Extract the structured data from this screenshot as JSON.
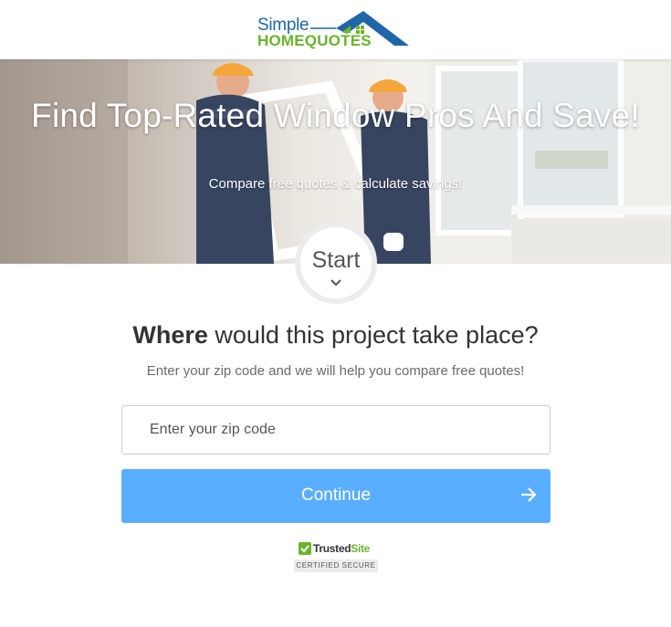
{
  "header": {
    "logo_simple": "Simple",
    "logo_homequotes": "HOMEQUOTES"
  },
  "hero": {
    "title": "Find Top-Rated Window Pros And Save!",
    "subtitle": "Compare free quotes & calculate savings!"
  },
  "start": {
    "label": "Start"
  },
  "form": {
    "question_bold": "Where",
    "question_rest": " would this project take place?",
    "help_text": "Enter your zip code and we will help you compare free quotes!",
    "zip_value": "",
    "zip_placeholder": "Enter your zip code",
    "continue_label": "Continue"
  },
  "trust": {
    "name_primary": "Trusted",
    "name_accent": "Site",
    "certified": "CERTIFIED SECURE"
  },
  "colors": {
    "brand_blue": "#1f66a8",
    "brand_green": "#6ab42d",
    "button": "#5aaeff"
  }
}
